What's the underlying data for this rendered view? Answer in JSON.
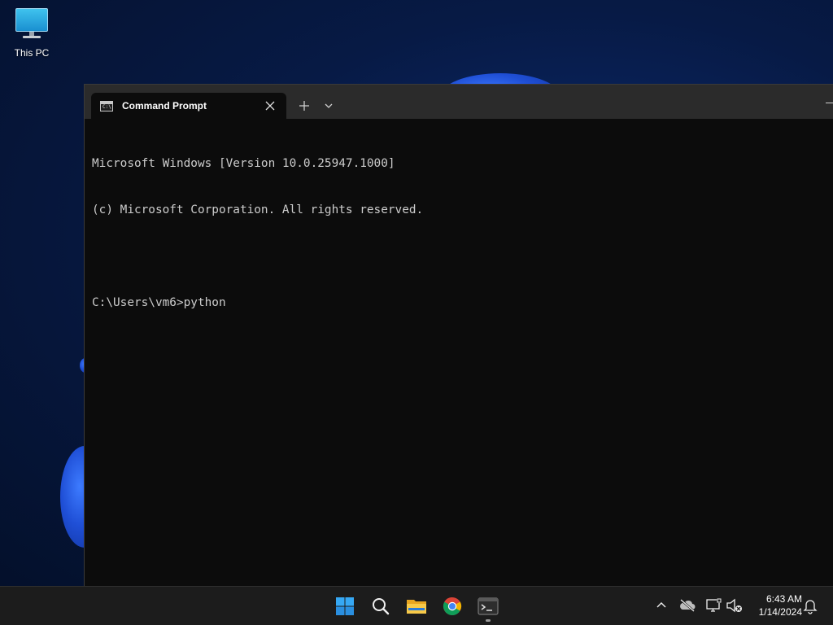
{
  "desktop": {
    "icons": [
      {
        "label": "This PC",
        "icon": "computer-monitor-icon"
      }
    ]
  },
  "window": {
    "tab_title": "Command Prompt",
    "tab_icon": "command-prompt-icon",
    "tab_icon_glyph": "C:\\",
    "close_icon": "close-icon",
    "new_tab_icon": "plus-icon",
    "dropdown_icon": "chevron-down-icon",
    "minimize_icon": "minimize-icon"
  },
  "console": {
    "lines": [
      "Microsoft Windows [Version 10.0.25947.1000]",
      "(c) Microsoft Corporation. All rights reserved.",
      "",
      "C:\\Users\\vm6>python"
    ]
  },
  "taskbar": {
    "apps": [
      {
        "name": "Start",
        "icon": "windows-start-icon"
      },
      {
        "name": "Search",
        "icon": "search-icon"
      },
      {
        "name": "File Explorer",
        "icon": "folder-icon"
      },
      {
        "name": "Google Chrome",
        "icon": "chrome-icon"
      },
      {
        "name": "Terminal",
        "icon": "terminal-icon",
        "active": true
      }
    ],
    "tray": {
      "icons": [
        "chevron-up-icon",
        "onedrive-offline-icon",
        "network-icon",
        "volume-muted-icon",
        "notification-bell-icon"
      ],
      "time": "6:43 AM",
      "date": "1/14/2024"
    }
  },
  "colors": {
    "console_bg": "#0c0c0c",
    "console_text": "#cccccc",
    "titlebar_bg": "#2b2b2b",
    "taskbar_bg": "#1c1c1c",
    "accent": "#2f7cf6"
  }
}
